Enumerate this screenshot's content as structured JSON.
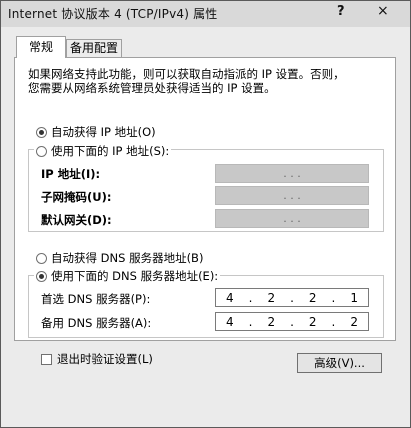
{
  "window": {
    "title": "Internet 协议版本 4 (TCP/IPv4) 属性",
    "help_glyph": "?",
    "close_glyph": "×"
  },
  "tabs": [
    {
      "label": "常规",
      "active": true
    },
    {
      "label": "备用配置",
      "active": false
    }
  ],
  "intro": {
    "line1": "如果网络支持此功能，则可以获取自动指派的 IP 设置。否则，",
    "line2": "您需要从网络系统管理员处获得适当的 IP 设置。"
  },
  "ip": {
    "auto_label": "自动获得 IP 地址(O)",
    "manual_label": "使用下面的 IP 地址(S):",
    "selected": "auto",
    "fields": [
      {
        "label": "IP 地址(I):",
        "value": ". . ."
      },
      {
        "label": "子网掩码(U):",
        "value": ". . ."
      },
      {
        "label": "默认网关(D):",
        "value": ". . ."
      }
    ]
  },
  "dns": {
    "auto_label": "自动获得 DNS 服务器地址(B)",
    "manual_label": "使用下面的 DNS 服务器地址(E):",
    "selected": "manual",
    "fields": [
      {
        "label": "首选 DNS 服务器(P):",
        "octets": [
          "4",
          "2",
          "2",
          "1"
        ]
      },
      {
        "label": "备用 DNS 服务器(A):",
        "octets": [
          "4",
          "2",
          "2",
          "2"
        ]
      }
    ]
  },
  "validate_label": "退出时验证设置(L)",
  "advanced_label": "高级(V)...",
  "octet_sep": "."
}
